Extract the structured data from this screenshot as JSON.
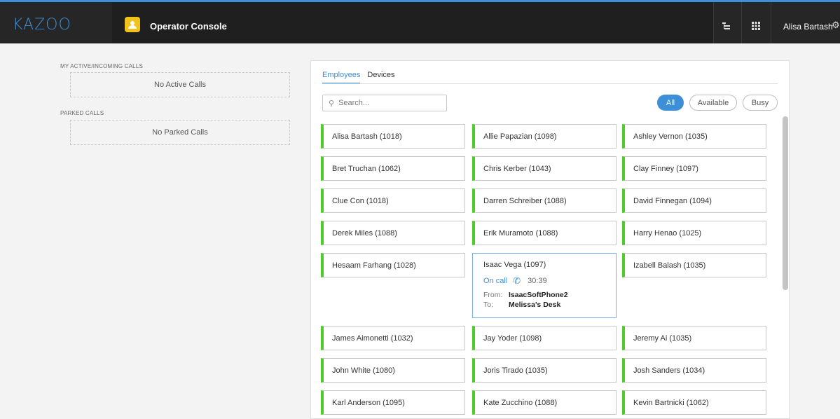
{
  "header": {
    "logo": "KAZOO",
    "app_title": "Operator Console",
    "user_name": "Alisa Bartash"
  },
  "left": {
    "active_label": "MY ACTIVE/INCOMING CALLS",
    "active_empty": "No Active Calls",
    "parked_label": "PARKED CALLS",
    "parked_empty": "No Parked Calls"
  },
  "panel": {
    "tabs": [
      {
        "label": "Employees",
        "active": true
      },
      {
        "label": "Devices",
        "active": false
      }
    ],
    "search_placeholder": "Search...",
    "filters": [
      "All",
      "Available",
      "Busy"
    ],
    "active_filter": "All"
  },
  "employees": [
    {
      "name": "Alisa Bartash (1018)"
    },
    {
      "name": "Allie Papazian (1098)"
    },
    {
      "name": "Ashley Vernon (1035)"
    },
    {
      "name": "Bret Truchan (1062)"
    },
    {
      "name": "Chris Kerber (1043)"
    },
    {
      "name": "Clay Finney (1097)"
    },
    {
      "name": "Clue Con (1018)"
    },
    {
      "name": "Darren Schreiber (1088)"
    },
    {
      "name": "David Finnegan (1094)"
    },
    {
      "name": "Derek Miles (1088)"
    },
    {
      "name": "Erik Muramoto (1088)"
    },
    {
      "name": "Harry Henao (1025)"
    },
    {
      "name": "Hesaam Farhang (1028)"
    },
    {
      "name": "Isaac Vega (1097)",
      "status": "On call",
      "duration": "30:39",
      "from_label": "From:",
      "from": "IsaacSoftPhone2",
      "to_label": "To:",
      "to": "Melissa's Desk"
    },
    {
      "name": "Izabell Balash (1035)"
    },
    {
      "name": "James Aimonetti (1032)"
    },
    {
      "name": "Jay Yoder (1098)"
    },
    {
      "name": "Jeremy Ai (1035)"
    },
    {
      "name": "John White (1080)"
    },
    {
      "name": "Joris Tirado (1035)"
    },
    {
      "name": "Josh Sanders (1034)"
    },
    {
      "name": "Karl Anderson (1095)"
    },
    {
      "name": "Kate Zucchino (1088)"
    },
    {
      "name": "Kevin Bartnicki (1062)"
    }
  ],
  "colors": {
    "accent": "#3d8fd8",
    "available": "#4fcb2b",
    "topbar": "#262627"
  }
}
